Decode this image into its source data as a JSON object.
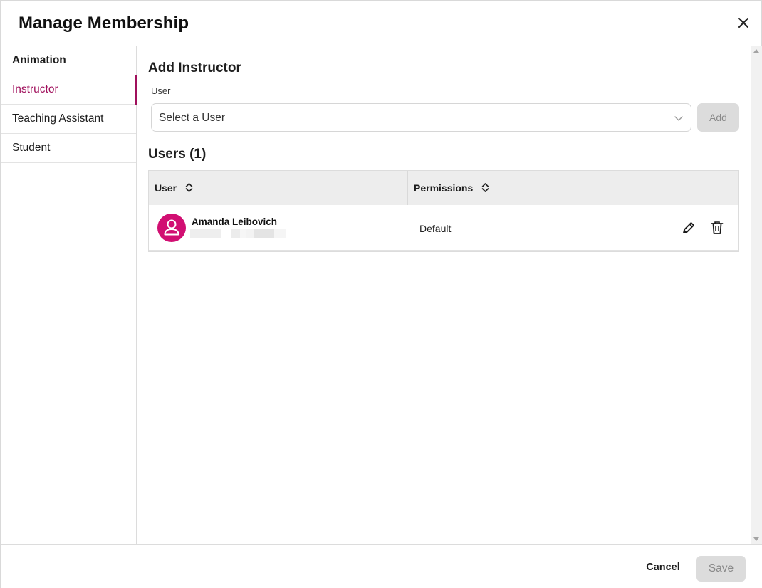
{
  "dialog": {
    "title": "Manage Membership",
    "close_icon": "close-icon"
  },
  "sidebar": {
    "items": [
      {
        "label": "Animation"
      },
      {
        "label": "Instructor"
      },
      {
        "label": "Teaching Assistant"
      },
      {
        "label": "Student"
      }
    ],
    "active": "Instructor",
    "accent_color": "#a0105c"
  },
  "add_section": {
    "title": "Add Instructor",
    "field_label": "User",
    "select_placeholder": "Select a User",
    "add_label": "Add"
  },
  "users_section": {
    "title": "Users (1)",
    "columns": [
      {
        "label": "User",
        "sort_icon": "sort-icon"
      },
      {
        "label": "Permissions",
        "sort_icon": "sort-icon"
      }
    ],
    "rows": [
      {
        "name": "Amanda Leibovich",
        "avatar_icon": "user-icon",
        "avatar_color": "#d10f72",
        "permission": "Default",
        "actions": [
          "edit-icon",
          "delete-icon"
        ]
      }
    ]
  },
  "footer": {
    "cancel_label": "Cancel",
    "save_label": "Save"
  }
}
